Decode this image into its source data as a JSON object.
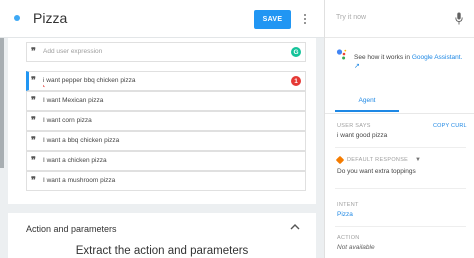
{
  "header": {
    "intent_name": "Pizza",
    "save_label": "SAVE"
  },
  "expressions": {
    "placeholder": "Add user expression",
    "items": [
      {
        "text": "i want pepper bbq chicken pizza",
        "error_count": "1"
      },
      {
        "text": "I want Mexican pizza"
      },
      {
        "text": "I want corn pizza"
      },
      {
        "text": "I want a bbq chicken pizza"
      },
      {
        "text": "I want a chicken pizza"
      },
      {
        "text": "I want a mushroom pizza"
      }
    ],
    "grammar_badge": "G"
  },
  "action_section": {
    "title": "Action and parameters",
    "subtitle": "Extract the action and parameters"
  },
  "try_panel": {
    "input_placeholder": "Try it now",
    "see_how_prefix": "See how it works in ",
    "see_how_link": "Google Assistant.",
    "tab_label": "Agent",
    "user_says_label": "USER SAYS",
    "copy_curl_label": "COPY CURL",
    "user_says_value": "i want good pizza",
    "default_response_label": "DEFAULT RESPONSE",
    "response_value": "Do you want extra toppings",
    "intent_label": "INTENT",
    "intent_value": "Pizza",
    "action_label": "ACTION",
    "action_value": "Not available"
  },
  "colors": {
    "accent": "#2196f3",
    "link": "#1e88e5",
    "error": "#e53935",
    "grammar": "#15c39a",
    "response_icon": "#f57c00"
  },
  "icons": [
    "status-dot",
    "more-vert-icon",
    "quote-icon",
    "grammarly-icon",
    "error-badge",
    "chevron-up-icon",
    "mic-icon",
    "google-assistant-icon",
    "external-link-icon",
    "default-response-icon",
    "dropdown-chevron-icon"
  ]
}
